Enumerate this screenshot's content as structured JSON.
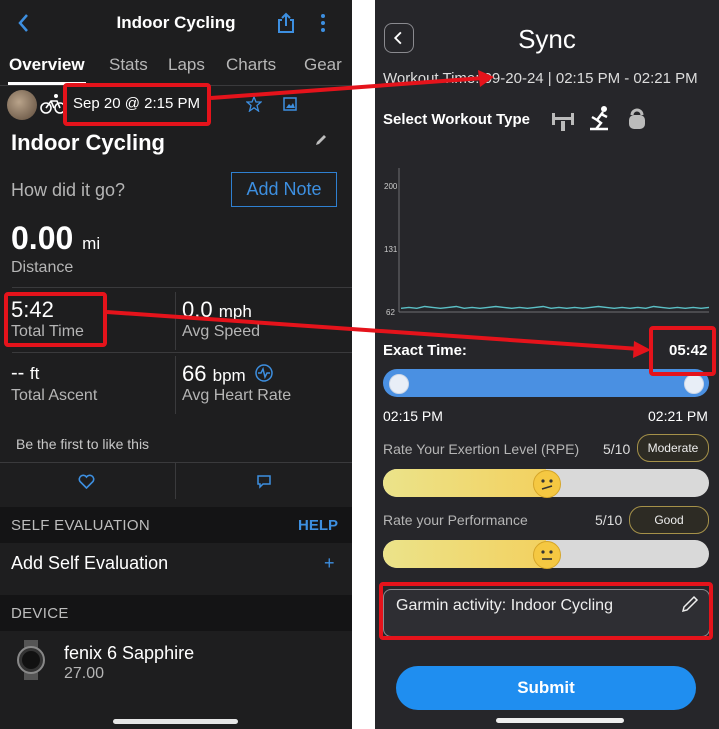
{
  "left": {
    "header": {
      "title": "Indoor Cycling"
    },
    "tabs": [
      "Overview",
      "Stats",
      "Laps",
      "Charts",
      "Gear"
    ],
    "activity": {
      "date": "Sep 20 @ 2:15 PM",
      "title": "Indoor Cycling",
      "prompt": "How did it go?",
      "add_note": "Add Note"
    },
    "stats": {
      "distance_value": "0.00",
      "distance_unit": "mi",
      "distance_label": "Distance",
      "time_value": "5:42",
      "time_label": "Total Time",
      "speed_value": "0.0",
      "speed_unit": "mph",
      "speed_label": "Avg Speed",
      "ascent_value": "--",
      "ascent_unit": "ft",
      "ascent_label": "Total Ascent",
      "hr_value": "66",
      "hr_unit": "bpm",
      "hr_label": "Avg Heart Rate"
    },
    "likes_text": "Be the first to like this",
    "self_eval": {
      "section": "SELF EVALUATION",
      "help": "HELP",
      "add": "Add Self Evaluation",
      "plus": "+"
    },
    "device": {
      "section": "DEVICE",
      "name": "fenix 6 Sapphire",
      "version": "27.00"
    }
  },
  "right": {
    "title": "Sync",
    "workout_time_label": "Workout Time",
    "workout_time_value": "09-20-24 | 02:15 PM - 02:21 PM",
    "select_type_label": "Select Workout Type",
    "exact_time_label": "Exact Time:",
    "exact_time_value": "05:42",
    "start_time": "02:15 PM",
    "end_time": "02:21 PM",
    "rpe": {
      "label": "Rate Your Exertion Level (RPE)",
      "value": "5/10",
      "badge": "Moderate",
      "level": 0.5
    },
    "performance": {
      "label": "Rate your Performance",
      "value": "5/10",
      "badge": "Good",
      "level": 0.5
    },
    "note": "Garmin activity: Indoor Cycling",
    "submit": "Submit"
  },
  "chart_data": {
    "type": "line",
    "yticks": [
      "200",
      "131",
      "62"
    ],
    "ylim": [
      62,
      200
    ],
    "y": [
      66,
      67,
      66,
      68,
      67,
      66,
      67,
      68,
      66,
      67,
      66,
      67,
      68,
      67,
      66,
      67,
      66,
      67,
      68,
      66,
      67,
      66,
      67,
      66,
      67,
      68,
      67,
      66,
      67,
      66,
      67,
      66,
      68,
      67,
      66,
      67,
      66,
      67,
      66,
      67
    ],
    "grid": false,
    "color": "#5bc0c6"
  },
  "colors": {
    "accent_blue": "#3d8fe0",
    "highlight_red": "#e5131b",
    "submit_blue": "#1f8ef0"
  }
}
